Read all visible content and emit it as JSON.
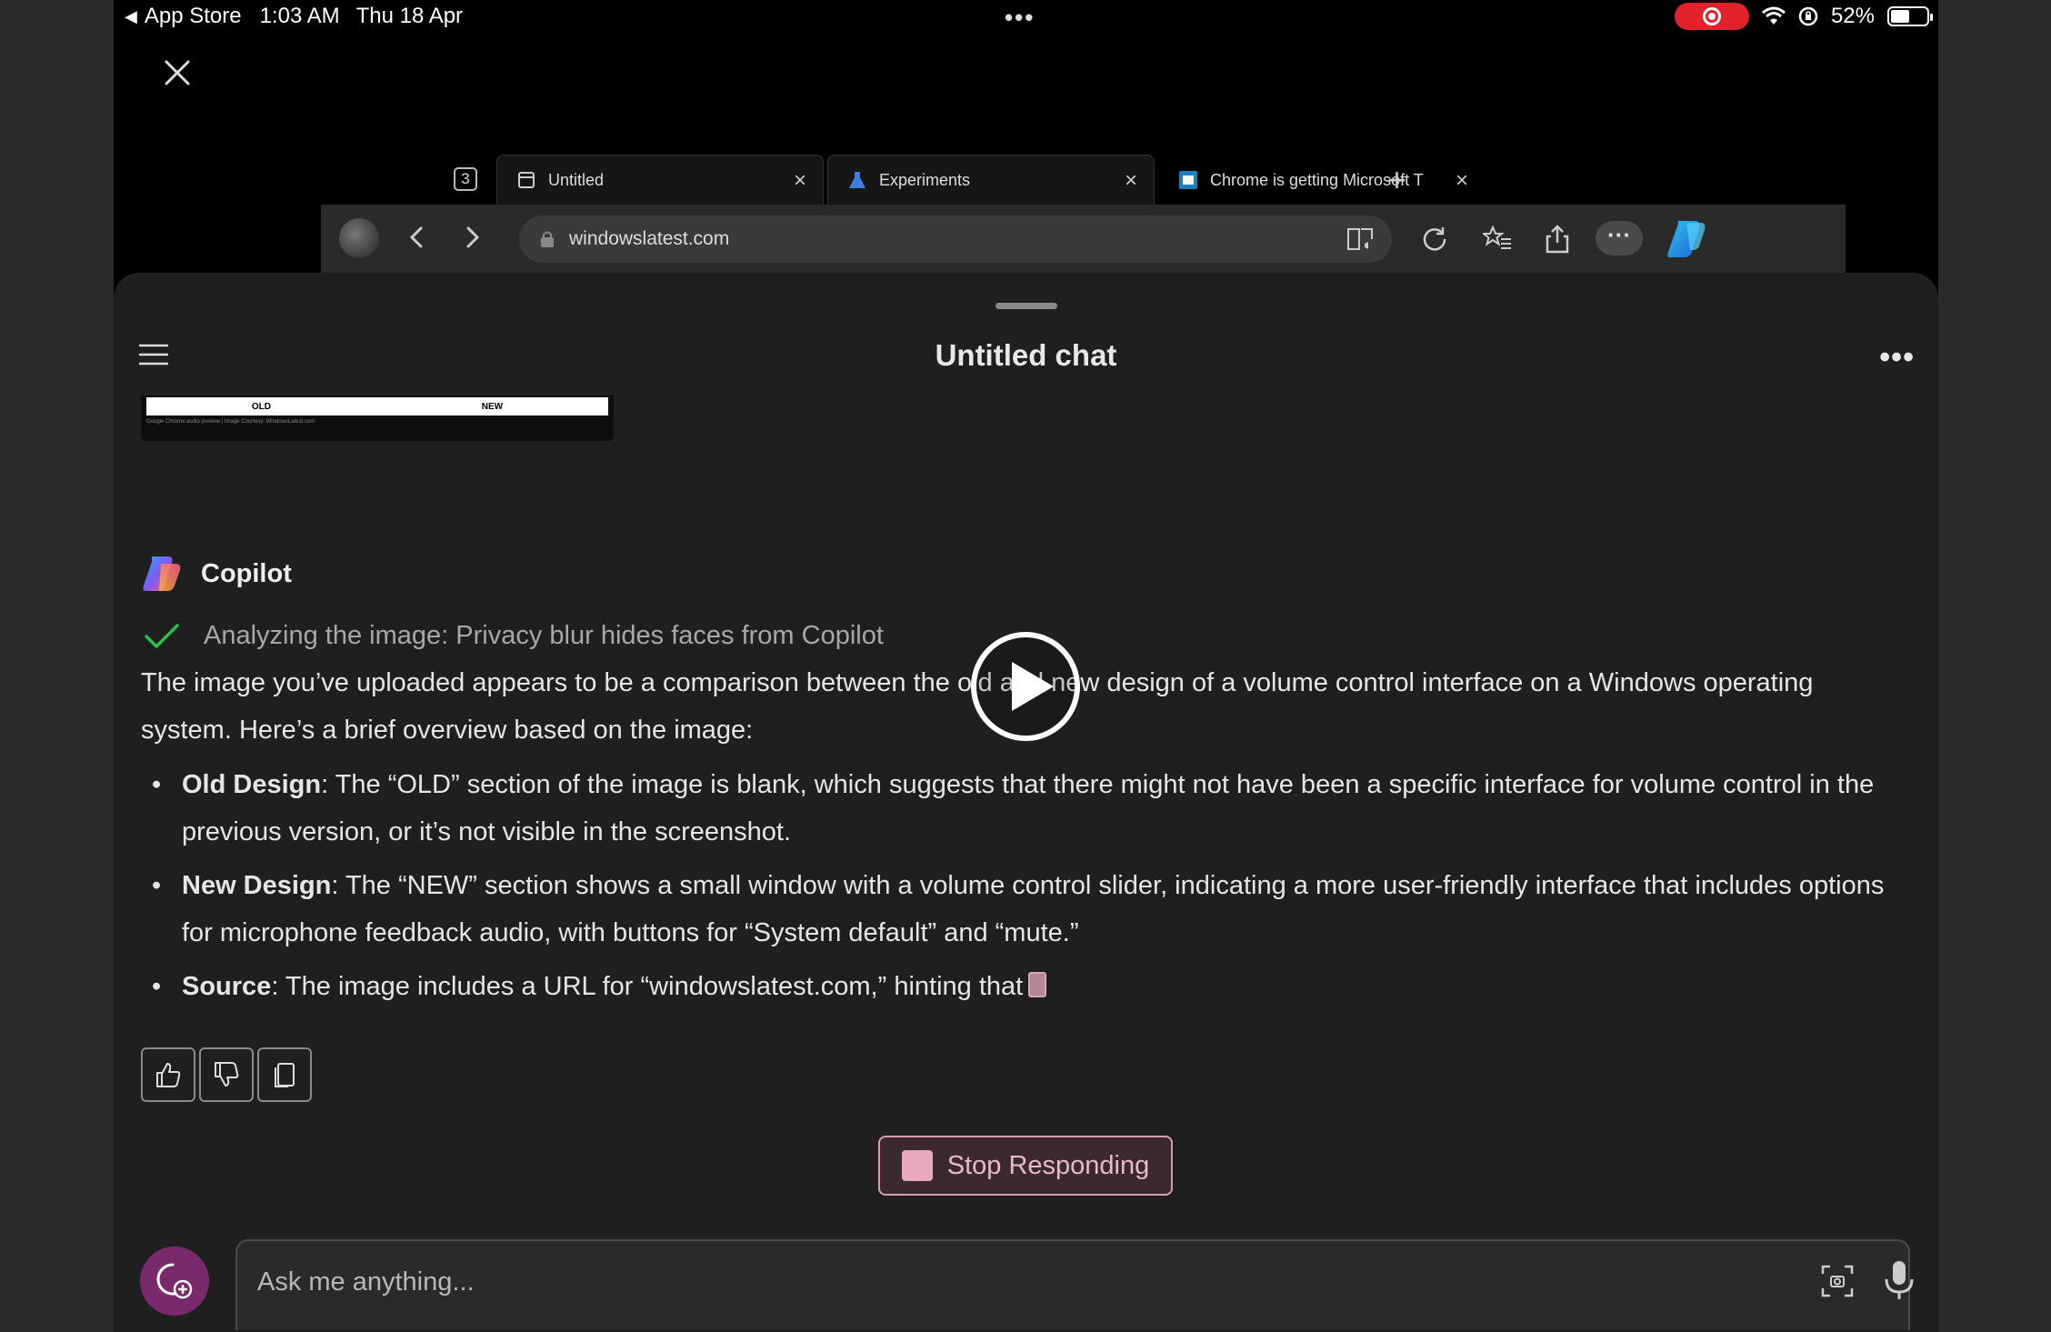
{
  "status_bar": {
    "back_app": "App Store",
    "time": "1:03 AM",
    "date": "Thu 18 Apr",
    "battery": "52%"
  },
  "browser": {
    "tab_count": "3",
    "tabs": [
      {
        "label": "Untitled"
      },
      {
        "label": "Experiments"
      },
      {
        "label": "Chrome is getting Microsoft T"
      }
    ],
    "url": "windowslatest.com"
  },
  "chat": {
    "title": "Untitled chat",
    "preview": {
      "old_label": "OLD",
      "new_label": "NEW",
      "caption": "Google Chrome audio preview | Image Courtesy: WindowsLatest.com"
    },
    "assistant_name": "Copilot",
    "status": "Analyzing the image: Privacy blur hides faces from Copilot",
    "intro": "The image you’ve uploaded appears to be a comparison between the old and new design of a volume control interface on a Windows operating system. Here’s a brief overview based on the image:",
    "bullets": [
      {
        "title": "Old Design",
        "text": ": The “OLD” section of the image is blank, which suggests that there might not have been a specific interface for volume control in the previous version, or it’s not visible in the screenshot."
      },
      {
        "title": "New Design",
        "text": ": The “NEW” section shows a small window with a volume control slider, indicating a more user-friendly interface that includes options for microphone feedback audio, with buttons for “System default” and “mute.”"
      },
      {
        "title": "Source",
        "text": ": The image includes a URL for “windowslatest.com,” hinting that"
      }
    ],
    "stop_label": "Stop Responding",
    "input_placeholder": "Ask me anything..."
  },
  "colors": {
    "accent_stop": "#e7a9bd",
    "check_green": "#2fbf4a",
    "new_chat_purple": "#7a2a6c",
    "record_red": "#e0222b"
  }
}
